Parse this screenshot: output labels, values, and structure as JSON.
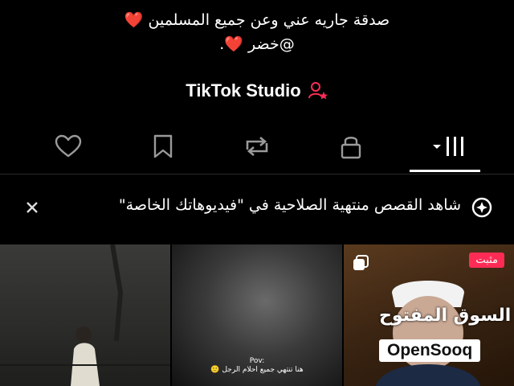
{
  "profile": {
    "bio_line1": "صدقة جاريه عني وعن جميع المسلمين ❤️",
    "bio_line2": "@خضر ❤️.",
    "studio_label": "TikTok Studio"
  },
  "tabs": [
    {
      "icon": "heart-icon",
      "active": false
    },
    {
      "icon": "bookmark-icon",
      "active": false
    },
    {
      "icon": "repost-icon",
      "active": false
    },
    {
      "icon": "lock-icon",
      "active": false
    },
    {
      "icon": "grid-icon",
      "active": true
    }
  ],
  "banner": {
    "text": "شاهد القصص منتهية الصلاحية في \"فيديوهاتك الخاصة\""
  },
  "videos": [
    {
      "kind": "photo"
    },
    {
      "pov_title": "Pov:",
      "pov_text": "هنا تنتهي جميع احلام الرجل 🙂"
    },
    {
      "pinned_label": "مثبت"
    }
  ],
  "watermark": {
    "arabic": "السوق المفتوح",
    "english": "OpenSooq"
  },
  "colors": {
    "accent": "#fe2c55",
    "heart": "#e0243f",
    "background": "#000000"
  }
}
